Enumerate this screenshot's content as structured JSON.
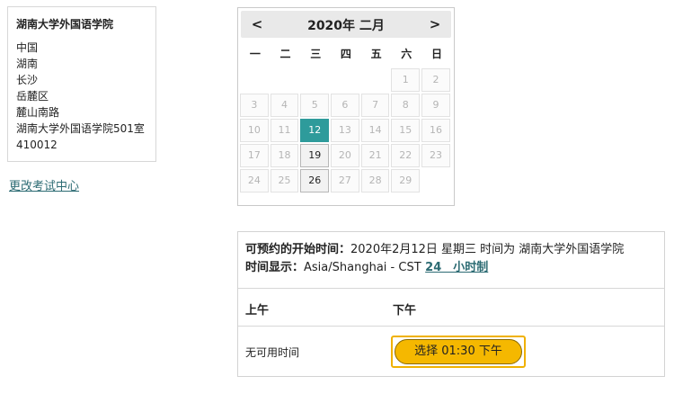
{
  "address": {
    "center_name": "湖南大学外国语学院",
    "lines": [
      "中国",
      "湖南",
      "长沙",
      "岳麓区",
      "麓山南路",
      "湖南大学外国语学院501室",
      "410012"
    ]
  },
  "change_center_label": "更改考试中心",
  "calendar": {
    "prev_label": "<",
    "next_label": ">",
    "title": "2020年 二月",
    "weekdays": [
      "一",
      "二",
      "三",
      "四",
      "五",
      "六",
      "日"
    ],
    "leading_blanks": 5,
    "days": [
      {
        "label": "1",
        "state": "disabled"
      },
      {
        "label": "2",
        "state": "disabled"
      },
      {
        "label": "3",
        "state": "disabled"
      },
      {
        "label": "4",
        "state": "disabled"
      },
      {
        "label": "5",
        "state": "disabled"
      },
      {
        "label": "6",
        "state": "disabled"
      },
      {
        "label": "7",
        "state": "disabled"
      },
      {
        "label": "8",
        "state": "disabled"
      },
      {
        "label": "9",
        "state": "disabled"
      },
      {
        "label": "10",
        "state": "disabled"
      },
      {
        "label": "11",
        "state": "disabled"
      },
      {
        "label": "12",
        "state": "selected"
      },
      {
        "label": "13",
        "state": "disabled"
      },
      {
        "label": "14",
        "state": "disabled"
      },
      {
        "label": "15",
        "state": "disabled"
      },
      {
        "label": "16",
        "state": "disabled"
      },
      {
        "label": "17",
        "state": "disabled"
      },
      {
        "label": "18",
        "state": "disabled"
      },
      {
        "label": "19",
        "state": "available"
      },
      {
        "label": "20",
        "state": "disabled"
      },
      {
        "label": "21",
        "state": "disabled"
      },
      {
        "label": "22",
        "state": "disabled"
      },
      {
        "label": "23",
        "state": "disabled"
      },
      {
        "label": "24",
        "state": "disabled"
      },
      {
        "label": "25",
        "state": "disabled"
      },
      {
        "label": "26",
        "state": "available"
      },
      {
        "label": "27",
        "state": "disabled"
      },
      {
        "label": "28",
        "state": "disabled"
      },
      {
        "label": "29",
        "state": "disabled"
      }
    ],
    "selected_color": "#2e9b9b"
  },
  "slots": {
    "start_label": "可预约的开始时间：",
    "start_value": "2020年2月12日 星期三 时间为 湖南大学外国语学院",
    "tz_label": "时间显示：",
    "tz_value": "Asia/Shanghai - CST",
    "time_format_link": "24　小时制",
    "am_header": "上午",
    "pm_header": "下午",
    "no_time_text": "无可用时间",
    "slot_button_label": "选择 01:30 下午",
    "button_color": "#f5b800"
  }
}
